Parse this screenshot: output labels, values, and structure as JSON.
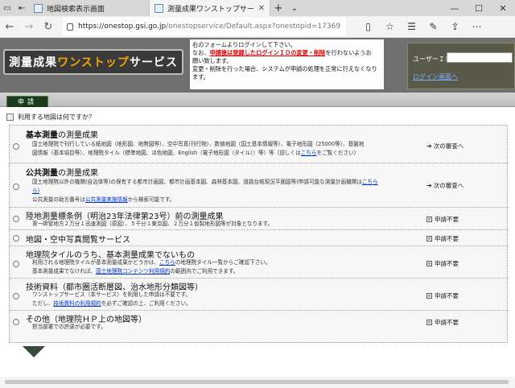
{
  "browser": {
    "tabs": [
      {
        "title": "地図検索表示画面"
      },
      {
        "title": "測量成果ワンストップサービ"
      }
    ],
    "address": {
      "host": "https://onestop.gsi.go.jp",
      "path": "/onestopservice/Default.aspx?onestopid=17369"
    }
  },
  "header": {
    "logo_main": "測量成果",
    "logo_accent": "ワンストップ",
    "logo_tail": "サービス",
    "notice": {
      "line1": "右のフォームよりログインして下さい。",
      "line2_pre": "なお、",
      "line2_red": "申請後は登録したログインＩＤの変更・削除",
      "line2_post": "を行わないようお",
      "line3": "願い致します。",
      "line4": "変更・削除を行った場合、システムが申請の処理を正常に行えなくなり",
      "line5": "ます。"
    },
    "login": {
      "uid_label": "ユーザーＩＤ",
      "uid_value": "",
      "login_link": "ログイン画面へ"
    }
  },
  "tabs": {
    "shinsei": "申請"
  },
  "question": "利用する地図は何ですか？",
  "options": [
    {
      "title_bold": "基本測量",
      "title_rest": "の測量成果",
      "desc1": "国土地理院で刊行している紙地図（地形図、地勢図等）、空中写真(刊行物）、数値地図（国土基本情報等）、電子地形図（25000等）、基盤地",
      "desc2_pre": "図情報（基本項目等）、地理院タイル（標準地図、淡色地図、English（電子地形図（タイル））等）等（詳しくは",
      "desc2_link": "こちら",
      "desc2_post": "をご覧ください）",
      "action": "次の審査へ"
    },
    {
      "title_bold": "公共測量",
      "title_rest": "の測量成果",
      "desc1_pre": "国土地理院以外の機関",
      "desc1_mid": "(自治体等)の保有する都市計画図、都市計画基本図、森林基本図、道路台帳現況平面図等(申請可能な測量計画機関は",
      "desc1_link": "こちら",
      "desc2": "ら)",
      "desc3_pre": "公共測量の助言番号は",
      "desc3_link": "公共測量実施情報",
      "desc3_post": "から検索可能です。",
      "action": "次の審査へ"
    },
    {
      "title": "陸地測量標条例（明治23年法律第23号）前の測量成果",
      "desc1": "第一師管地方２万分１迅速測図（原図）、５千分１東京図、２万分１仮製地形図等が対象となります。",
      "action": "申請不要"
    },
    {
      "title": "地図・空中写真閲覧サービス",
      "action": "申請不要"
    },
    {
      "title": "地理院タイルのうち、基本測量成果でないもの",
      "desc1_pre": "利用される地理院タイルが基本測量成果かどうかは、",
      "desc1_link": "こちら",
      "desc1_post": "の地理院タイル一覧からご確認下さい。",
      "desc2_pre": "基本測量成果でなければ、",
      "desc2_link": "国土地理院コンテンツ利用規約",
      "desc2_post": "の範囲内でご利用できます。",
      "action": "申請不要"
    },
    {
      "title": "技術資料（都市圏活断層図、治水地形分類図等）",
      "desc1": "ワンストップサービス（本サービス）を利用した申請は不要です。",
      "desc2_pre": "ただし、",
      "desc2_link": "技術資料の利用規約",
      "desc2_post": "を必ずご確認の上、ご利用ください。",
      "action": "申請不要"
    },
    {
      "title": "その他（地理院ＨＰ上の地図等）",
      "desc1": "担当部署での許諾が必要です。",
      "action": "申請不要"
    }
  ]
}
